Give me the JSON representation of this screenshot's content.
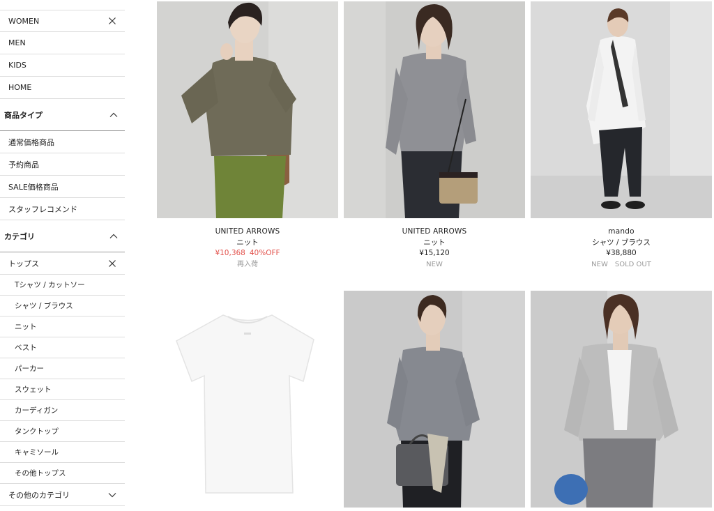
{
  "sidebar": {
    "genders": [
      {
        "label": "WOMEN",
        "selected": true
      },
      {
        "label": "MEN"
      },
      {
        "label": "KIDS"
      },
      {
        "label": "HOME"
      }
    ],
    "product_type": {
      "heading": "商品タイプ",
      "items": [
        "通常価格商品",
        "予約商品",
        "SALE価格商品",
        "スタッフレコメンド"
      ]
    },
    "category": {
      "heading": "カテゴリ",
      "selected": "トップス",
      "items": [
        "Tシャツ / カットソー",
        "シャツ / ブラウス",
        "ニット",
        "ベスト",
        "パーカー",
        "スウェット",
        "カーディガン",
        "タンクトップ",
        "キャミソール",
        "その他トップス"
      ],
      "other": "その他のカテゴリ"
    }
  },
  "products": [
    {
      "brand": "UNITED ARROWS",
      "type": "ニット",
      "price": "¥10,368",
      "discount": "40%OFF",
      "badges": [
        "再入荷"
      ]
    },
    {
      "brand": "UNITED ARROWS",
      "type": "ニット",
      "price": "¥15,120",
      "badges": [
        "NEW"
      ]
    },
    {
      "brand": "mando",
      "type": "シャツ / ブラウス",
      "price": "¥38,880",
      "badges": [
        "NEW",
        "SOLD OUT"
      ]
    }
  ],
  "colors": {
    "sale": "#e2504a",
    "badge": "#9a9a9a",
    "divider": "#dcdcdc"
  }
}
